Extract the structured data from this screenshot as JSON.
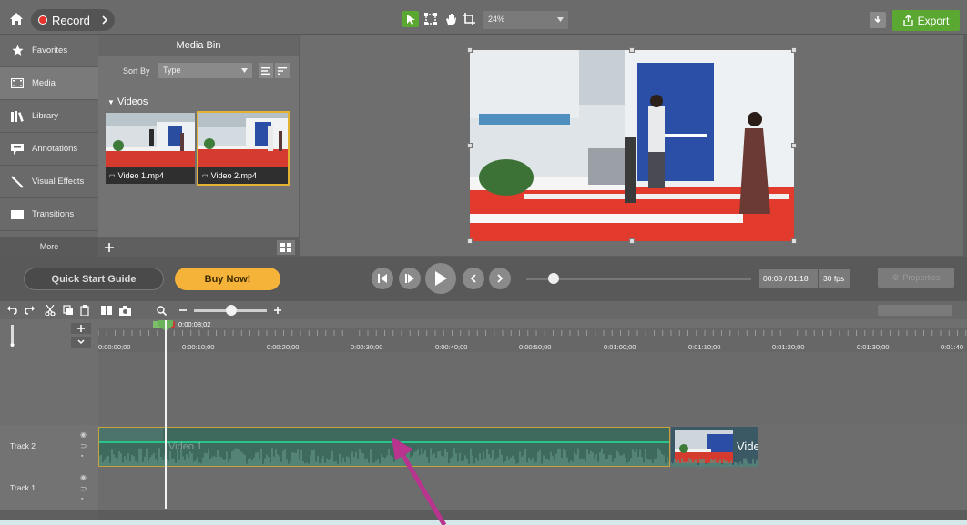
{
  "topbar": {
    "record_label": "Record",
    "zoom": "24%",
    "export_label": "Export"
  },
  "sidenav": {
    "items": [
      {
        "label": "Favorites",
        "icon": "star-icon"
      },
      {
        "label": "Media",
        "icon": "film-icon"
      },
      {
        "label": "Library",
        "icon": "library-icon"
      },
      {
        "label": "Annotations",
        "icon": "annotation-icon"
      },
      {
        "label": "Visual Effects",
        "icon": "wand-icon"
      },
      {
        "label": "Transitions",
        "icon": "transition-icon"
      }
    ],
    "more_label": "More"
  },
  "media_bin": {
    "title": "Media Bin",
    "sort_label": "Sort By",
    "sort_value": "Type",
    "section_label": "Videos",
    "clips": [
      {
        "name": "Video 1.mp4",
        "selected": false
      },
      {
        "name": "Video 2.mp4",
        "selected": true
      }
    ]
  },
  "controls": {
    "quick_start_label": "Quick Start Guide",
    "buy_now_label": "Buy Now!",
    "time": "00:08 / 01:18",
    "fps": "30 fps",
    "properties_label": "Properties",
    "accent_buy": "#f6b33a",
    "accent_export": "#5aa832"
  },
  "timeline": {
    "playhead_time": "0:00:08;02",
    "ticks": [
      "0:00:00;00",
      "0:00:10;00",
      "0:00:20;00",
      "0:00:30;00",
      "0:00:40;00",
      "0:00:50;00",
      "0:01:00;00",
      "0:01:10;00",
      "0:01:20;00",
      "0:01:30;00",
      "0:01:40"
    ],
    "tracks": [
      {
        "label": "Track 2"
      },
      {
        "label": "Track 1"
      }
    ],
    "clips": [
      {
        "label": "Video 1"
      },
      {
        "label": "Vide"
      }
    ]
  }
}
